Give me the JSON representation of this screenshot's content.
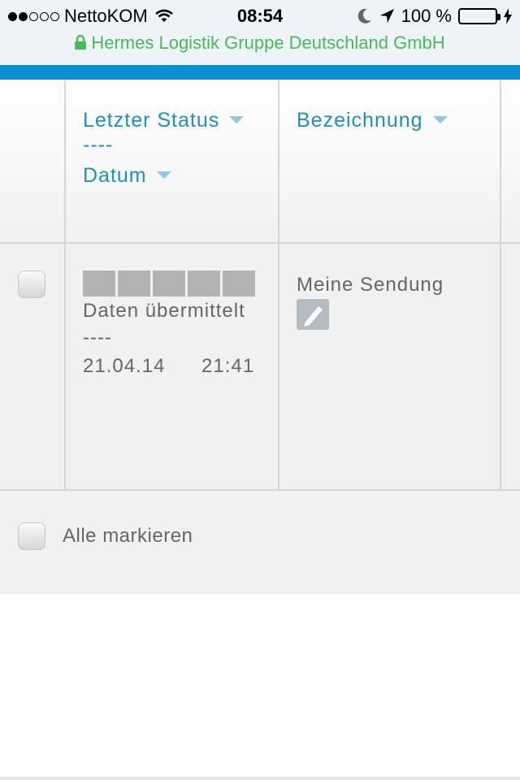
{
  "status_bar": {
    "carrier": "NettoKOM",
    "time": "08:54",
    "battery_percent": "100 %",
    "battery_level": 1.0,
    "signal_bars_filled": 2,
    "signal_bars_total": 5,
    "icons": [
      "signal-dots",
      "wifi-icon",
      "moon-icon",
      "location-arrow-icon",
      "battery-icon",
      "charging-bolt-icon"
    ]
  },
  "url_bar": {
    "site_name": "Hermes Logistik Gruppe Deutschland GmbH",
    "secure_icon": "lock-icon"
  },
  "colors": {
    "accent_blue": "#0a8fcf",
    "link_blue": "#1f8fbe",
    "secure_green": "#4cb85c",
    "battery_green": "#4cd964"
  },
  "table": {
    "headers": {
      "status_label": "Letzter Status",
      "separator": "----",
      "date_label": "Datum",
      "name_label": "Bezeichnung"
    },
    "rows": [
      {
        "status": "Daten übermittelt",
        "separator": "----",
        "date": "21.04.14",
        "time": "21:41",
        "name": "Meine Sendung"
      }
    ]
  },
  "footer": {
    "select_all_label": "Alle markieren"
  }
}
